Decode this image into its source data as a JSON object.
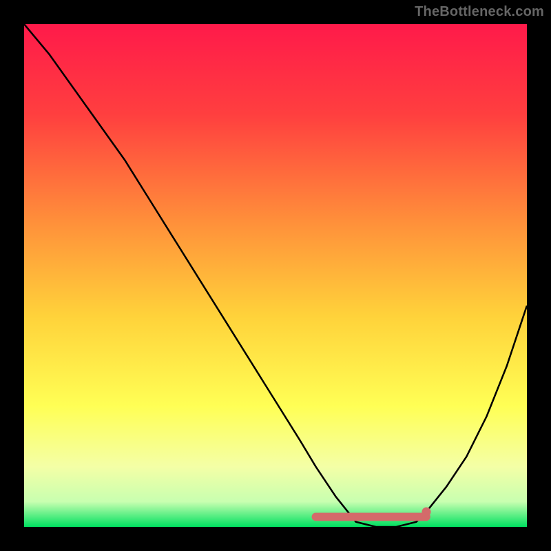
{
  "attribution": "TheBottleneck.com",
  "chart_data": {
    "type": "line",
    "title": "",
    "xlabel": "",
    "ylabel": "",
    "xlim": [
      0,
      100
    ],
    "ylim": [
      0,
      100
    ],
    "background_gradient": {
      "stops": [
        {
          "offset": 0,
          "color": "#ff1a4a"
        },
        {
          "offset": 18,
          "color": "#ff3f3f"
        },
        {
          "offset": 40,
          "color": "#ff923a"
        },
        {
          "offset": 58,
          "color": "#ffd23a"
        },
        {
          "offset": 76,
          "color": "#ffff55"
        },
        {
          "offset": 88,
          "color": "#f4ffa6"
        },
        {
          "offset": 95,
          "color": "#c8ffb0"
        },
        {
          "offset": 100,
          "color": "#00e060"
        }
      ]
    },
    "curve": {
      "x": [
        0,
        5,
        10,
        15,
        20,
        25,
        30,
        35,
        40,
        45,
        50,
        55,
        58,
        62,
        66,
        70,
        74,
        78,
        80,
        84,
        88,
        92,
        96,
        100
      ],
      "y": [
        100,
        94,
        87,
        80,
        73,
        65,
        57,
        49,
        41,
        33,
        25,
        17,
        12,
        6,
        1,
        0,
        0,
        1,
        3,
        8,
        14,
        22,
        32,
        44
      ]
    },
    "marker_band": {
      "x_start": 58,
      "x_end": 80,
      "y": 2,
      "color": "#d46a6a"
    },
    "marker_dot": {
      "x": 80,
      "y": 3,
      "color": "#d46a6a"
    }
  }
}
